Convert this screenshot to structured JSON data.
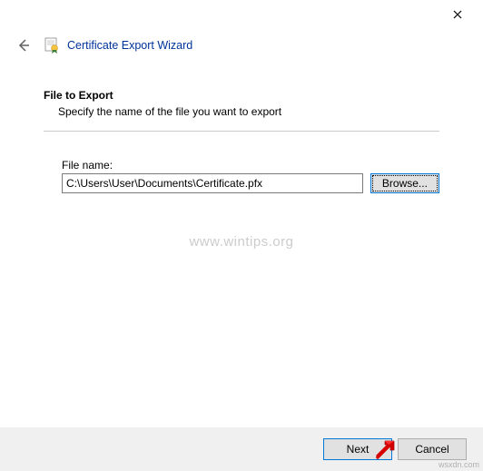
{
  "window": {
    "title": "Certificate Export Wizard"
  },
  "section": {
    "title": "File to Export",
    "description": "Specify the name of the file you want to export"
  },
  "field": {
    "label": "File name:",
    "value": "C:\\Users\\User\\Documents\\Certificate.pfx",
    "browse_label": "Browse..."
  },
  "footer": {
    "next_label": "Next",
    "cancel_label": "Cancel"
  },
  "watermark": "www.wintips.org",
  "attribution": "wsxdn.com"
}
